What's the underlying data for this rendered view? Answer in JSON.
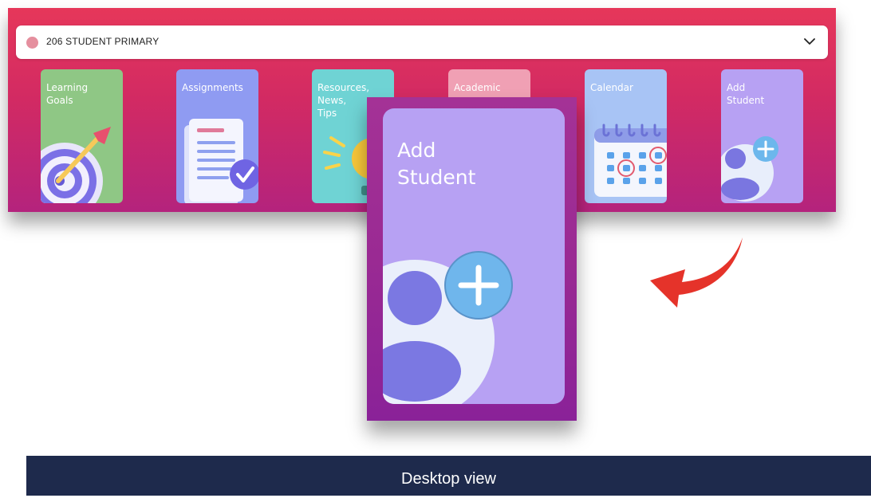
{
  "student_select": {
    "value": "206 STUDENT PRIMARY"
  },
  "tiles": [
    {
      "label": "Learning\nGoals",
      "color": "#8fc785",
      "icon": "target-icon"
    },
    {
      "label": "Assignments",
      "color": "#8f9bf2",
      "icon": "assignment-icon"
    },
    {
      "label": "Resources,\nNews,\nTips",
      "color": "#6fd3d4",
      "icon": "lightbulb-icon"
    },
    {
      "label": "Academic",
      "color": "#f0a0b4",
      "icon": "academic-icon"
    },
    {
      "label": "Calendar",
      "color": "#a8c4f5",
      "icon": "calendar-icon"
    },
    {
      "label": "Add\nStudent",
      "color": "#b7a1f3",
      "icon": "add-student-icon"
    }
  ],
  "zoom": {
    "label": "Add\nStudent"
  },
  "footer": {
    "caption": "Desktop view"
  },
  "colors": {
    "banner_top": "#e6375a",
    "banner_bottom": "#b4237d",
    "footer_bg": "#1e2a4c",
    "arrow": "#e5332a"
  }
}
